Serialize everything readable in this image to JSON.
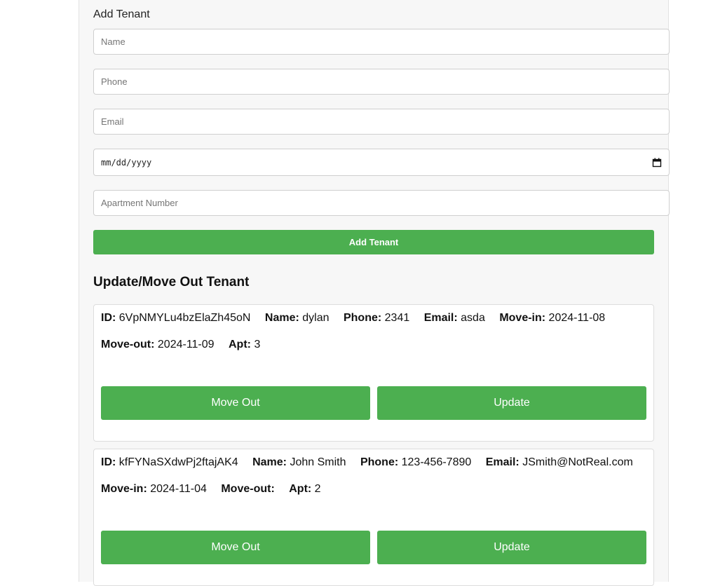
{
  "form": {
    "title": "Add Tenant",
    "name_placeholder": "Name",
    "phone_placeholder": "Phone",
    "email_placeholder": "Email",
    "date_placeholder": "mm/dd/yyyy",
    "apartment_placeholder": "Apartment Number",
    "submit_label": "Add Tenant"
  },
  "tenants_section": {
    "title": "Update/Move Out Tenant",
    "field_labels": {
      "id": "ID:",
      "name": "Name:",
      "phone": "Phone:",
      "email": "Email:",
      "move_in": "Move-in:",
      "move_out": "Move-out:",
      "apt": "Apt:"
    },
    "move_out_label": "Move Out",
    "update_label": "Update",
    "tenants": [
      {
        "id": "6VpNMYLu4bzElaZh45oN",
        "name": "dylan",
        "phone": "2341",
        "email": "asda",
        "move_in": "2024-11-08",
        "move_out": "2024-11-09",
        "apt": "3"
      },
      {
        "id": "kfFYNaSXdwPj2ftajAK4",
        "name": "John Smith",
        "phone": "123-456-7890",
        "email": "JSmith@NotReal.com",
        "move_in": "2024-11-04",
        "move_out": "",
        "apt": "2"
      }
    ]
  },
  "colors": {
    "accent": "#4caf50",
    "panel_background": "#f7f7f7"
  },
  "icons": {
    "date_picker": "calendar-icon"
  }
}
